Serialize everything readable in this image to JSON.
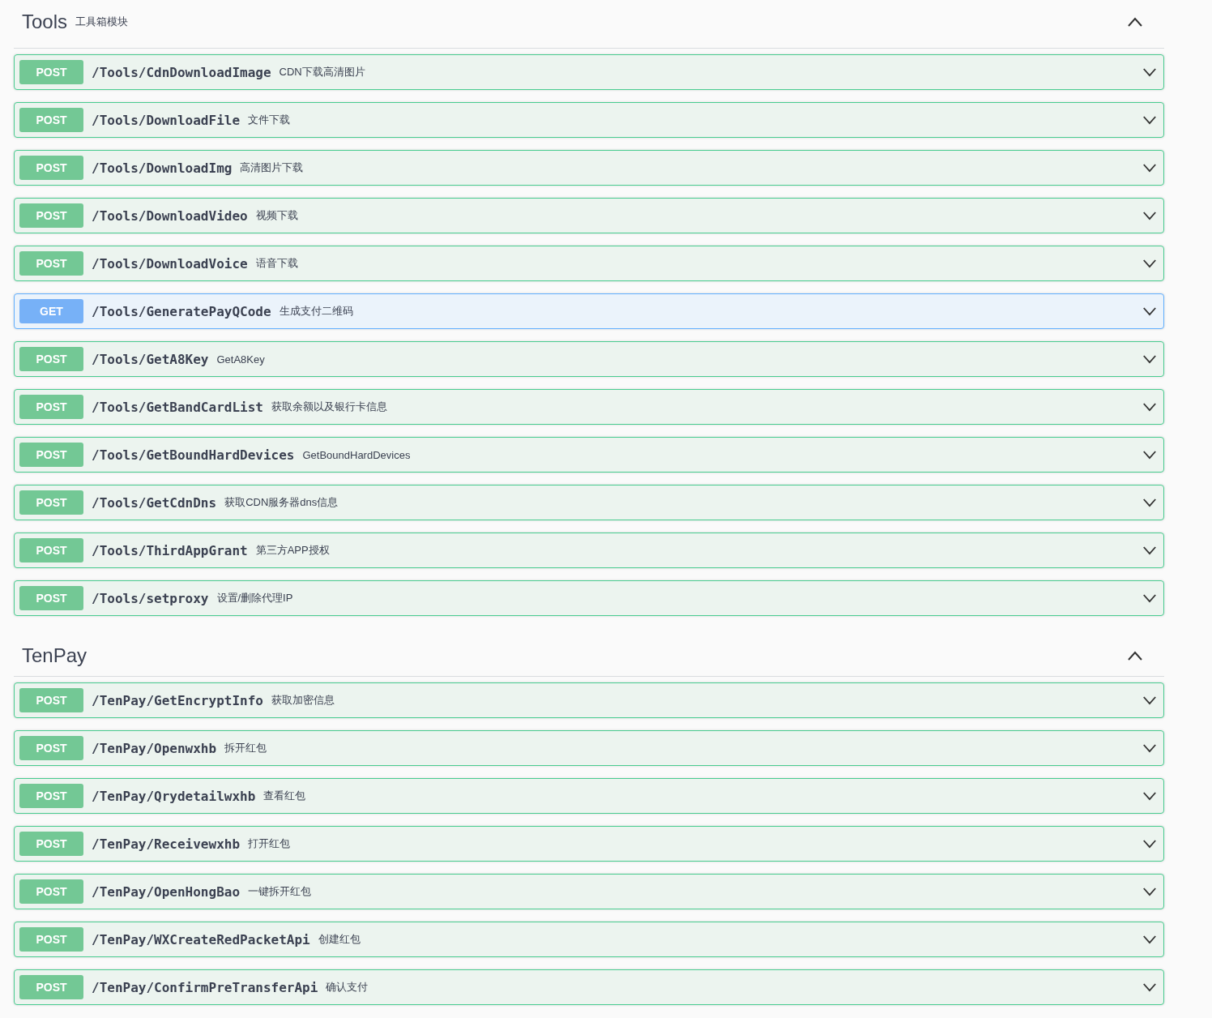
{
  "sections": [
    {
      "title": "Tools",
      "description": "工具箱模块",
      "expanded": true,
      "operations": [
        {
          "kind": "post",
          "method": "POST",
          "path": "/Tools/CdnDownloadImage",
          "summary": "CDN下载高清图片",
          "expanded": false
        },
        {
          "kind": "post",
          "method": "POST",
          "path": "/Tools/DownloadFile",
          "summary": "文件下载",
          "expanded": false
        },
        {
          "kind": "post",
          "method": "POST",
          "path": "/Tools/DownloadImg",
          "summary": "高清图片下载",
          "expanded": false
        },
        {
          "kind": "post",
          "method": "POST",
          "path": "/Tools/DownloadVideo",
          "summary": "视频下载",
          "expanded": false
        },
        {
          "kind": "post",
          "method": "POST",
          "path": "/Tools/DownloadVoice",
          "summary": "语音下载",
          "expanded": false
        },
        {
          "kind": "get",
          "method": "GET",
          "path": "/Tools/GeneratePayQCode",
          "summary": "生成支付二维码",
          "expanded": false
        },
        {
          "kind": "post",
          "method": "POST",
          "path": "/Tools/GetA8Key",
          "summary": "GetA8Key",
          "expanded": false
        },
        {
          "kind": "post",
          "method": "POST",
          "path": "/Tools/GetBandCardList",
          "summary": "获取余额以及银行卡信息",
          "expanded": false
        },
        {
          "kind": "post",
          "method": "POST",
          "path": "/Tools/GetBoundHardDevices",
          "summary": "GetBoundHardDevices",
          "expanded": false
        },
        {
          "kind": "post",
          "method": "POST",
          "path": "/Tools/GetCdnDns",
          "summary": "获取CDN服务器dns信息",
          "expanded": false
        },
        {
          "kind": "post",
          "method": "POST",
          "path": "/Tools/ThirdAppGrant",
          "summary": "第三方APP授权",
          "expanded": false
        },
        {
          "kind": "post",
          "method": "POST",
          "path": "/Tools/setproxy",
          "summary": "设置/删除代理IP",
          "expanded": false
        }
      ]
    },
    {
      "title": "TenPay",
      "expanded": true,
      "operations": [
        {
          "kind": "post",
          "method": "POST",
          "path": "/TenPay/GetEncryptInfo",
          "summary": "获取加密信息",
          "expanded": false
        },
        {
          "kind": "post",
          "method": "POST",
          "path": "/TenPay/Openwxhb",
          "summary": "拆开红包",
          "expanded": false
        },
        {
          "kind": "post",
          "method": "POST",
          "path": "/TenPay/Qrydetailwxhb",
          "summary": "查看红包",
          "expanded": false
        },
        {
          "kind": "post",
          "method": "POST",
          "path": "/TenPay/Receivewxhb",
          "summary": "打开红包",
          "expanded": false
        },
        {
          "kind": "post",
          "method": "POST",
          "path": "/TenPay/OpenHongBao",
          "summary": "一键拆开红包",
          "expanded": false
        },
        {
          "kind": "post",
          "method": "POST",
          "path": "/TenPay/WXCreateRedPacketApi",
          "summary": "创建红包",
          "expanded": false
        },
        {
          "kind": "post",
          "method": "POST",
          "path": "/TenPay/ConfirmPreTransferApi",
          "summary": "确认支付",
          "expanded": false
        }
      ]
    }
  ]
}
